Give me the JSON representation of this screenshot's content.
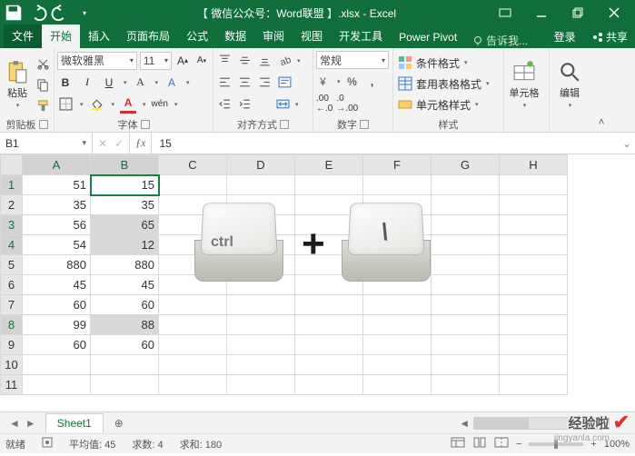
{
  "titlebar": {
    "filename": "【 微信公众号：Word联盟 】.xlsx - Excel"
  },
  "tabs": {
    "file": "文件",
    "home": "开始",
    "insert": "插入",
    "layout": "页面布局",
    "formulas": "公式",
    "data": "数据",
    "review": "审阅",
    "view": "视图",
    "dev": "开发工具",
    "pivot": "Power Pivot",
    "tell": "告诉我...",
    "login": "登录",
    "share": "共享"
  },
  "ribbon": {
    "clipboard": {
      "paste": "粘贴",
      "label": "剪贴板"
    },
    "font": {
      "name": "微软雅黑",
      "size": "11",
      "label": "字体",
      "bold": "B",
      "italic": "I",
      "underline": "U",
      "ruby": "wén"
    },
    "align": {
      "label": "对齐方式"
    },
    "number": {
      "format": "常规",
      "label": "数字"
    },
    "styles": {
      "cond": "条件格式",
      "table": "套用表格格式",
      "cell": "单元格样式",
      "label": "样式"
    },
    "cells": {
      "label": "单元格"
    },
    "editing": {
      "label": "编辑"
    }
  },
  "fx": {
    "namebox": "B1",
    "value": "15"
  },
  "grid": {
    "cols": [
      "A",
      "B",
      "C",
      "D",
      "E",
      "F",
      "G",
      "H"
    ],
    "rows": [
      "1",
      "2",
      "3",
      "4",
      "5",
      "6",
      "7",
      "8",
      "9",
      "10"
    ],
    "dataA": [
      "51",
      "35",
      "56",
      "54",
      "880",
      "45",
      "60",
      "99",
      "60",
      ""
    ],
    "dataB": [
      "15",
      "35",
      "65",
      "12",
      "880",
      "45",
      "60",
      "88",
      "60",
      ""
    ]
  },
  "overlay": {
    "ctrl": "ctrl",
    "plus": "+",
    "slash": "\\"
  },
  "sheetbar": {
    "sheet1": "Sheet1"
  },
  "status": {
    "ready": "就绪",
    "avg_lbl": "平均值:",
    "avg": "45",
    "cnt_lbl": "求数:",
    "cnt": "4",
    "sum_lbl": "求和:",
    "sum": "180",
    "zoom": "100%"
  },
  "watermark": {
    "main": "经验啦",
    "sub": "jingyanla.com"
  }
}
